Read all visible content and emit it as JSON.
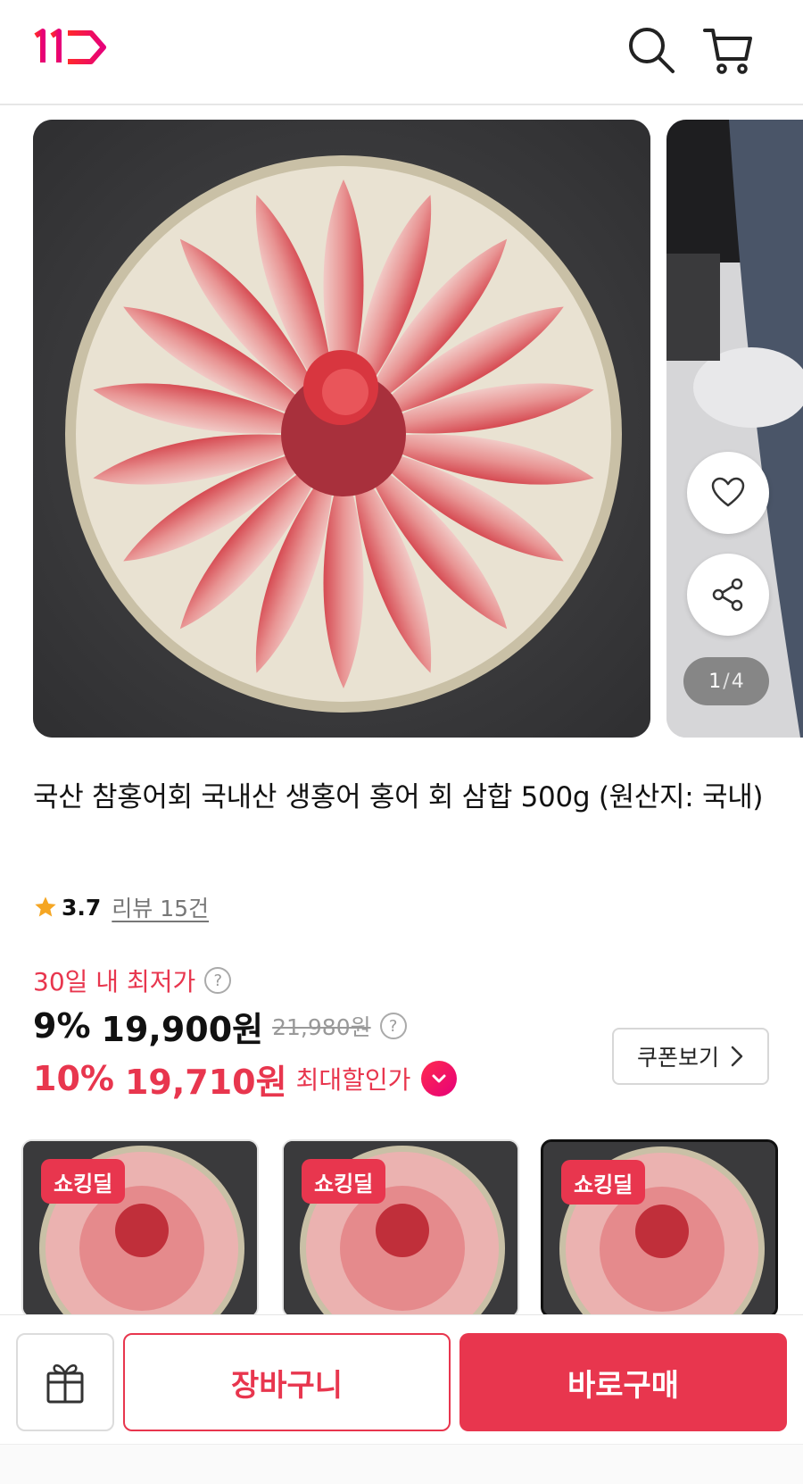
{
  "header": {
    "logo_text": "11",
    "search_icon": "search-icon",
    "cart_icon": "cart-icon"
  },
  "gallery": {
    "current": "1",
    "separator": "/",
    "total": "4"
  },
  "product": {
    "title": "국산 참홍어회 국내산 생홍어 홍어 회 삼합 500g (원산지: 국내)",
    "rating": "3.7",
    "reviews_label": "리뷰 15건"
  },
  "price": {
    "lowest_label": "30일 내 최저가",
    "discount_rate": "9%",
    "sale_price": "19,900원",
    "original_price": "21,980원",
    "max_discount_rate": "10%",
    "max_price": "19,710원",
    "max_label": "최대할인가",
    "coupon_label": "쿠폰보기",
    "accent_color": "#e8364e"
  },
  "options": [
    {
      "badge": "쇼킹딜"
    },
    {
      "badge": "쇼킹딜"
    },
    {
      "badge": "쇼킹딜"
    }
  ],
  "bottom_bar": {
    "cart_label": "장바구니",
    "buy_label": "바로구매"
  }
}
